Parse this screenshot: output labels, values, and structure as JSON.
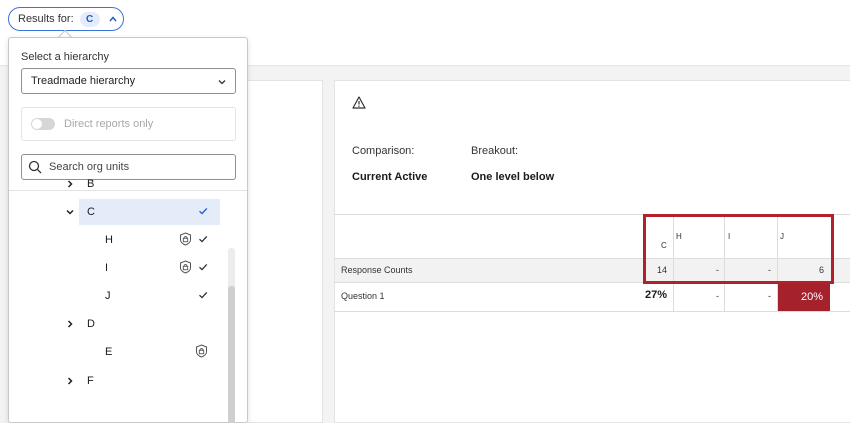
{
  "header": {
    "results_label": "Results for:",
    "results_value": "C",
    "toggle_icon": "chevron-up-icon"
  },
  "panel": {
    "hierarchy_label": "Select a hierarchy",
    "hierarchy_value": "Treadmade hierarchy",
    "direct_reports_label": "Direct reports only",
    "direct_reports_on": false,
    "search_placeholder": "Search org units",
    "tree": [
      {
        "label": "B",
        "expandable": true,
        "expanded": false,
        "checked": false,
        "locked": false
      },
      {
        "label": "C",
        "expandable": true,
        "expanded": true,
        "checked": true,
        "locked": false,
        "selected": true
      },
      {
        "label": "H",
        "expandable": false,
        "checked": true,
        "locked": true
      },
      {
        "label": "I",
        "expandable": false,
        "checked": true,
        "locked": true
      },
      {
        "label": "J",
        "expandable": false,
        "checked": true,
        "locked": false
      },
      {
        "label": "D",
        "expandable": true,
        "expanded": false,
        "checked": false,
        "locked": false
      },
      {
        "label": "E",
        "expandable": false,
        "checked": false,
        "locked": true
      },
      {
        "label": "F",
        "expandable": true,
        "expanded": false,
        "checked": false,
        "locked": false
      }
    ]
  },
  "report": {
    "warning_icon": "warning-icon",
    "comparison_label": "Comparison:",
    "breakout_label": "Breakout:",
    "comparison_value": "Current Active",
    "breakout_value": "One level below",
    "columns": [
      "C",
      "H",
      "I",
      "J"
    ],
    "rows": [
      {
        "label": "Response Counts",
        "values": [
          "14",
          "-",
          "-",
          "6"
        ]
      },
      {
        "label": "Question 1",
        "values": [
          "27%",
          "-",
          "-",
          "20%"
        ]
      }
    ],
    "colors": {
      "highlight": "#a5222d",
      "frame": "#b3202c",
      "accent": "#3b73d9"
    }
  }
}
